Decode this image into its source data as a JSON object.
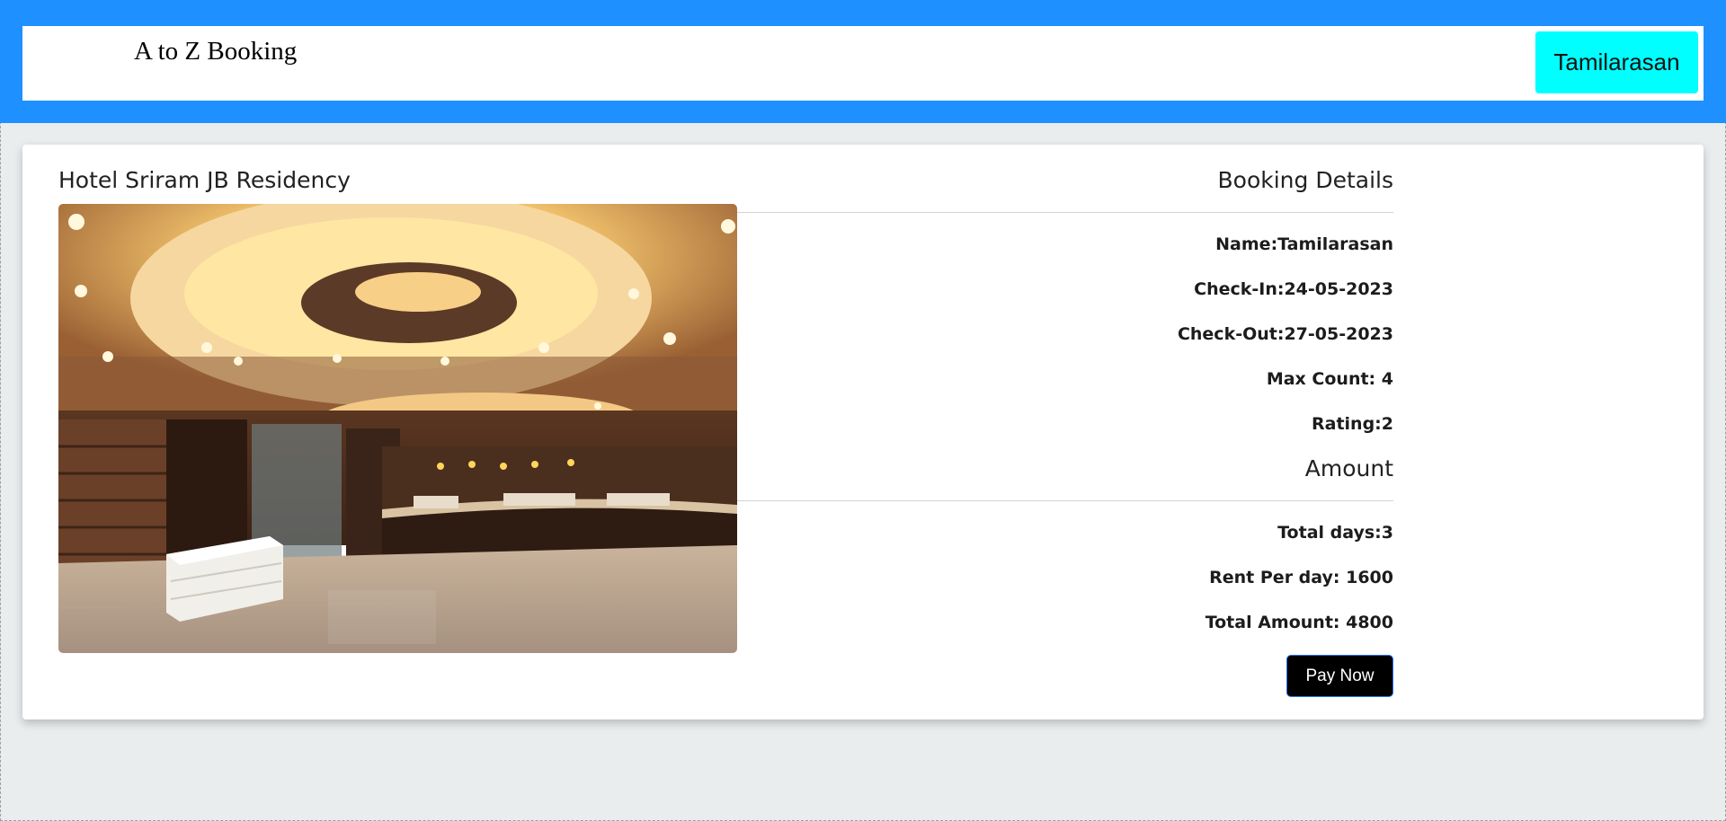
{
  "header": {
    "brand": "A to Z Booking",
    "user_button": "Tamilarasan"
  },
  "hotel": {
    "name": "Hotel Sriram JB Residency",
    "image_icon": "hotel-lobby-photo"
  },
  "booking_details": {
    "title": "Booking Details",
    "name": "Name:Tamilarasan",
    "check_in": "Check-In:24-05-2023",
    "check_out": "Check-Out:27-05-2023",
    "max_count": "Max Count: 4",
    "rating": "Rating:2"
  },
  "amount": {
    "title": "Amount",
    "total_days": "Total days:3",
    "rent_per_day": "Rent Per day: 1600",
    "total_amount": "Total Amount: 4800",
    "pay_button": "Pay Now"
  },
  "colors": {
    "header_bg": "#1e90ff",
    "user_button_bg": "#00ffff",
    "page_bg": "#e9edee",
    "pay_button_bg": "#000000"
  }
}
